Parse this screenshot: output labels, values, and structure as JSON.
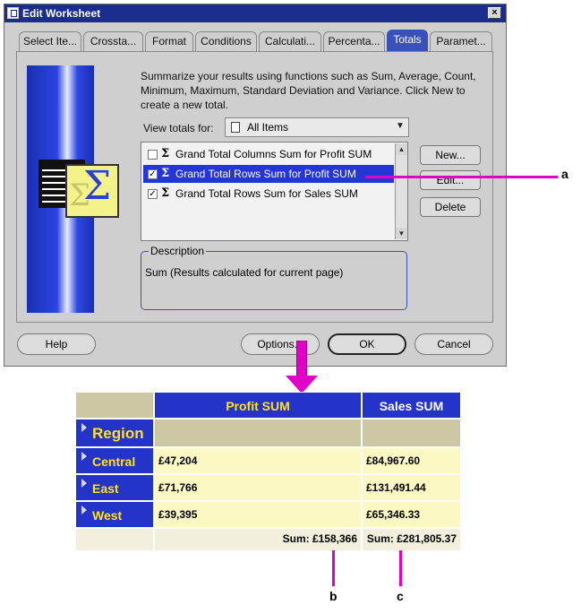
{
  "window": {
    "title": "Edit Worksheet",
    "close_label": "×"
  },
  "tabs": [
    {
      "label": "Select Ite..."
    },
    {
      "label": "Crossta..."
    },
    {
      "label": "Format"
    },
    {
      "label": "Conditions"
    },
    {
      "label": "Calculati..."
    },
    {
      "label": "Percenta..."
    },
    {
      "label": "Totals",
      "active": true
    },
    {
      "label": "Paramet..."
    }
  ],
  "panel": {
    "description_line1": "Summarize your results using functions such as Sum, Average, Count,",
    "description_line2": "Minimum, Maximum, Standard Deviation and Variance.  Click New to",
    "description_line3": "create a new total.",
    "view_totals_label": "View totals for:",
    "view_totals_value": "All Items",
    "totals": [
      {
        "label": "Grand Total Columns Sum for Profit SUM",
        "checked": false,
        "selected": false
      },
      {
        "label": "Grand Total Rows Sum for Profit SUM",
        "checked": true,
        "selected": true
      },
      {
        "label": "Grand Total Rows Sum for Sales SUM",
        "checked": true,
        "selected": false
      }
    ],
    "side_buttons": {
      "new": "New...",
      "edit": "Edit...",
      "delete": "Delete"
    },
    "desc_group_title": "Description",
    "desc_text": "Sum (Results calculated for current page)"
  },
  "bottom_buttons": {
    "help": "Help",
    "options": "Options...",
    "ok": "OK",
    "cancel": "Cancel"
  },
  "callouts": {
    "a": "a",
    "b": "b",
    "c": "c"
  },
  "crosstab": {
    "col_headers": [
      "Profit SUM",
      "Sales SUM"
    ],
    "row_axis_label": "Region",
    "rows": [
      {
        "region": "Central",
        "profit": "£47,204",
        "sales": "£84,967.60"
      },
      {
        "region": "East",
        "profit": "£71,766",
        "sales": "£131,491.44"
      },
      {
        "region": "West",
        "profit": "£39,395",
        "sales": "£65,346.33"
      }
    ],
    "sum_profit": "Sum: £158,366",
    "sum_sales": "Sum: £281,805.37"
  },
  "colors": {
    "accent": "#2433c8",
    "highlight": "#ffe21a",
    "callout": "#e000c8"
  }
}
